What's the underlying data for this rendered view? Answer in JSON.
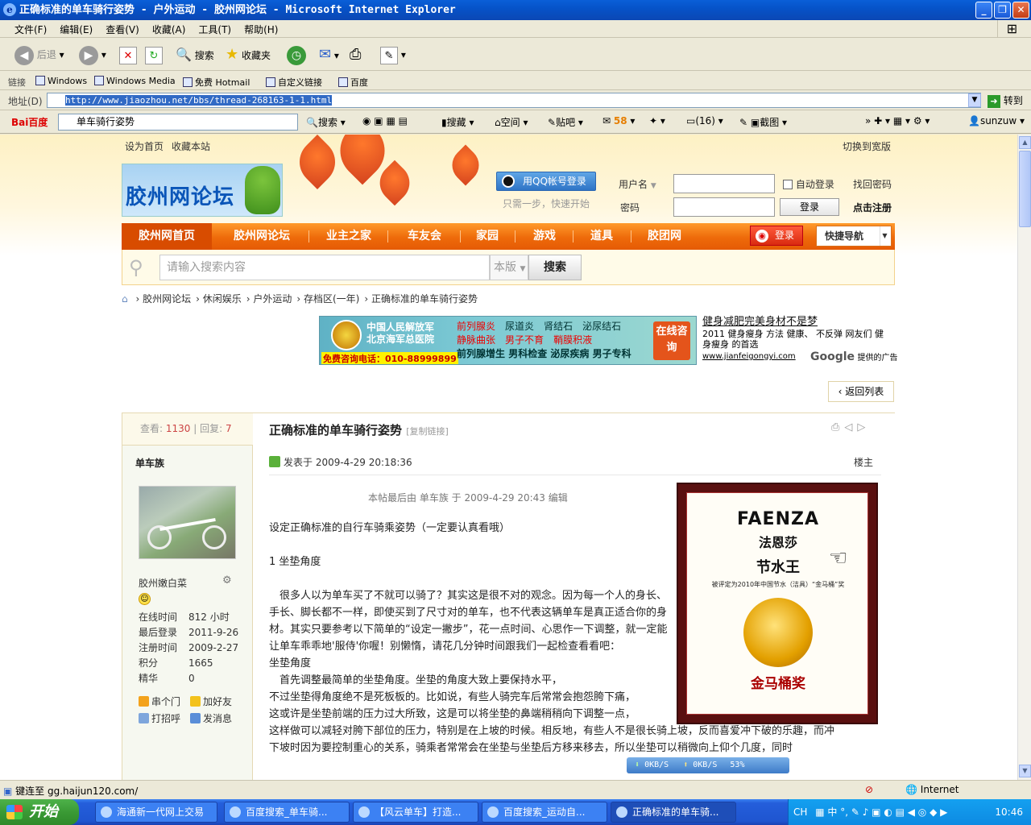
{
  "window": {
    "title": "正确标准的单车骑行姿势 - 户外运动 - 胶州网论坛 - Microsoft Internet Explorer"
  },
  "menubar": [
    "文件(F)",
    "编辑(E)",
    "查看(V)",
    "收藏(A)",
    "工具(T)",
    "帮助(H)"
  ],
  "toolbar": {
    "back": "后退",
    "search": "搜索",
    "favorites": "收藏夹"
  },
  "links": {
    "label": "链接",
    "items": [
      "Windows",
      "Windows Media",
      "免费 Hotmail",
      "自定义链接",
      "百度"
    ]
  },
  "address": {
    "label": "地址(D)",
    "url": "http://www.jiaozhou.net/bbs/thread-268163-1-1.html",
    "go": "转到"
  },
  "baidu": {
    "logo": "Bai百度",
    "query": "单车骑行姿势",
    "search": "搜索",
    "favorite": "搜藏",
    "space": "空间",
    "tieba": "贴吧",
    "count": "58",
    "mail": "(16)",
    "screenshot": "截图",
    "user": "sunzuw"
  },
  "page": {
    "toplinks": [
      "设为首页",
      "收藏本站"
    ],
    "widescreen": "切换到宽版",
    "logo_text": "胶州网论坛",
    "qq_login": "用QQ帐号登录",
    "qq_tip": "只需一步，快速开始",
    "username_label": "用户名",
    "password_label": "密码",
    "auto_login": "自动登录",
    "find_password": "找回密码",
    "login_button": "登录",
    "register": "点击注册",
    "nav": [
      "胶州网首页",
      "胶州网论坛",
      "业主之家",
      "车友会",
      "家园",
      "游戏",
      "道具",
      "胶团网"
    ],
    "weibo_login": "登录",
    "quick_nav": "快捷导航",
    "search_placeholder": "请输入搜索内容",
    "search_scope": "本版",
    "search_button": "搜索",
    "breadcrumb": [
      "胶州网论坛",
      "休闲娱乐",
      "户外运动",
      "存档区(一年)",
      "正确标准的单车骑行姿势"
    ],
    "ad1": {
      "hospital": "中国人民解放军",
      "hospital2": "北京海军总医院",
      "phone": "免费咨询电话：010-88999899",
      "items": [
        [
          "前列腺炎",
          "尿道炎",
          "肾结石",
          "泌尿结石"
        ],
        [
          "静脉曲张",
          "男子不育",
          "鞘膜积液"
        ],
        [
          "前列腺增生",
          "男科检查",
          "泌尿疾病",
          "男子专科"
        ]
      ],
      "consult": "在线咨询"
    },
    "ad2": {
      "title": "健身减肥完美身材不是梦",
      "body": "2011 健身瘦身 方法 健康、 不反弹 网友们 健身瘦身 的首选",
      "url": "www.jianfeigongyi.com",
      "google": "Google",
      "provided": "提供的广告"
    },
    "back_to_list": "返回列表",
    "stats": {
      "views_label": "查看:",
      "views": "1130",
      "replies_label": "回复:",
      "replies": "7"
    },
    "author": "单车族",
    "user_title": "胶州嫩白菜",
    "user_info": [
      [
        "在线时间",
        "812 小时"
      ],
      [
        "最后登录",
        "2011-9-26"
      ],
      [
        "注册时间",
        "2009-2-27"
      ],
      [
        "积分",
        "1665"
      ],
      [
        "精华",
        "0"
      ]
    ],
    "actions": [
      "串个门",
      "加好友",
      "打招呼",
      "发消息"
    ],
    "post_title": "正确标准的单车骑行姿势",
    "copy_link": "[复制链接]",
    "post_time": "发表于 2009-4-29 20:18:36",
    "floor": "楼主",
    "edited": "本帖最后由 单车族 于 2009-4-29 20:43 编辑",
    "body": [
      "设定正确标准的自行车骑乘姿势（一定要认真看哦）",
      "",
      "1 坐垫角度",
      "",
      "　很多人以为单车买了不就可以骑了？其实这是很不对的观念。因为每一个人的身长、手长、脚长都不一样，即使买到了尺寸对的单车，也不代表这辆单车是真正适合你的身材。其实只要参考以下简单的“设定一撇步”，花一点时间、心思作一下调整，就一定能让单车乖乖地'服侍'你喔！别懒惰，请花几分钟时间跟我们一起检查看看吧：",
      "坐垫角度",
      "　首先调整最简单的坐垫角度。坐垫的角度大致上要保持水平，"
    ],
    "body_wide": [
      "不过坐垫得角度绝不是死板板的。比如说，有些人骑完车后常常会抱怨胯下痛，",
      "这或许是坐垫前端的压力过大所致，这是可以将坐垫的鼻端稍稍向下调整一点，",
      "这样做可以减轻对胯下部位的压力，特别是在上坡的时候。相反地，有些人不是很长骑上坡，反而喜爱冲下破的乐趣，而冲",
      "下坡时因为要控制重心的关系，骑乘者常常会在坐垫与坐垫后方移来移去，所以坐垫可以稍微向上仰个几度，同时"
    ],
    "faenza": {
      "brand": "FAENZA",
      "cn": "法恩莎",
      "slogan": "节水王",
      "sub": "被评定为2010年中国节水（洁具）“金马桶”奖",
      "award": "金马桶奖"
    },
    "download": {
      "down": "0KB/S",
      "up": "0KB/S",
      "pct": "53%"
    }
  },
  "status": {
    "text": "键连至 gg.haijun120.com/",
    "zone": "Internet"
  },
  "taskbar": {
    "start": "开始",
    "tasks": [
      "海通新一代网上交易",
      "百度搜索_单车骑...",
      "【风云单车】打造...",
      "百度搜索_运动自...",
      "正确标准的单车骑..."
    ],
    "lang": "CH",
    "time": "10:46"
  }
}
